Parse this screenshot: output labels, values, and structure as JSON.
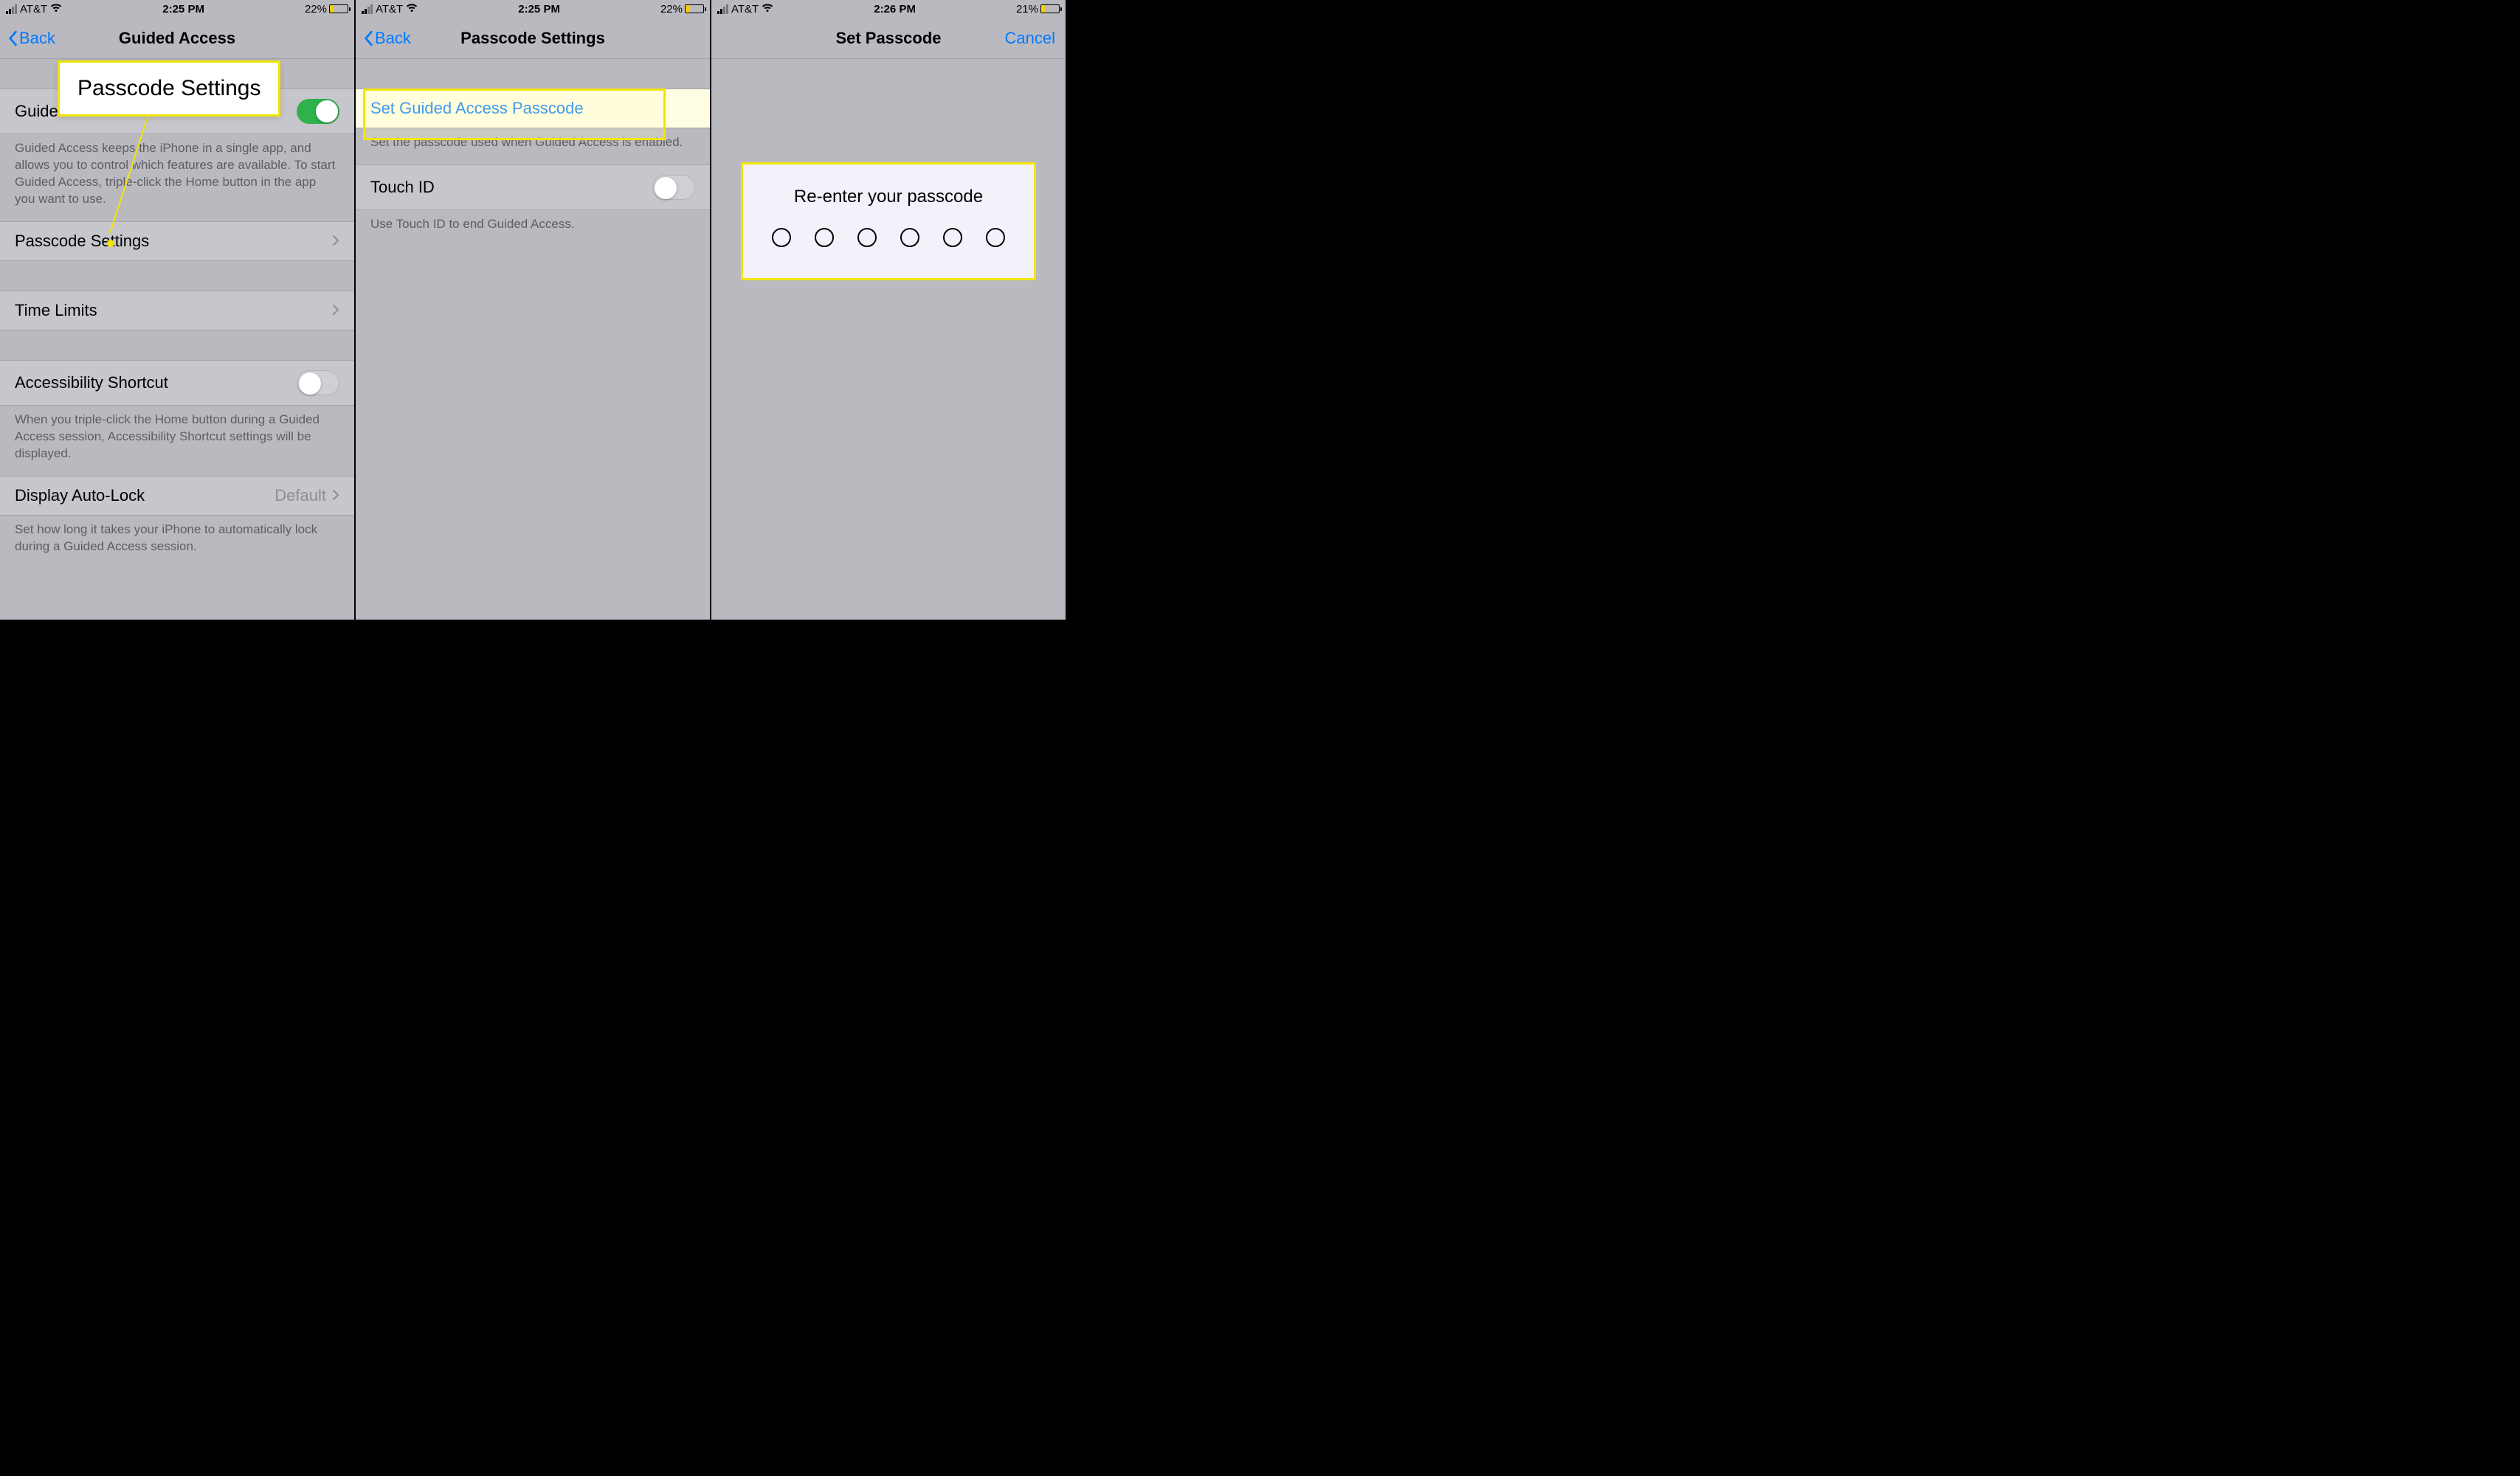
{
  "panel1": {
    "status": {
      "carrier": "AT&T",
      "time": "2:25 PM",
      "battery_pct": "22%",
      "battery_fill": 22
    },
    "nav": {
      "back": "Back",
      "title": "Guided Access"
    },
    "guided_access_row": "Guided Access",
    "guided_access_toggle": true,
    "guided_access_desc": "Guided Access keeps the iPhone in a single app, and allows you to control which features are available. To start Guided Access, triple-click the Home button in the app you want to use.",
    "passcode_settings_row": "Passcode Settings",
    "time_limits_row": "Time Limits",
    "accessibility_shortcut_row": "Accessibility Shortcut",
    "accessibility_shortcut_toggle": false,
    "accessibility_shortcut_desc": "When you triple-click the Home button during a Guided Access session, Accessibility Shortcut settings will be displayed.",
    "display_autolock_row": "Display Auto-Lock",
    "display_autolock_value": "Default",
    "display_autolock_desc": "Set how long it takes your iPhone to automatically lock during a Guided Access session.",
    "callout_label": "Passcode Settings"
  },
  "panel2": {
    "status": {
      "carrier": "AT&T",
      "time": "2:25 PM",
      "battery_pct": "22%",
      "battery_fill": 22
    },
    "nav": {
      "back": "Back",
      "title": "Passcode Settings"
    },
    "set_passcode_row": "Set Guided Access Passcode",
    "set_passcode_desc": "Set the passcode used when Guided Access is enabled.",
    "touchid_row": "Touch ID",
    "touchid_toggle": false,
    "touchid_desc": "Use Touch ID to end Guided Access."
  },
  "panel3": {
    "status": {
      "carrier": "AT&T",
      "time": "2:26 PM",
      "battery_pct": "21%",
      "battery_fill": 21
    },
    "nav": {
      "title": "Set Passcode",
      "cancel": "Cancel"
    },
    "prompt": "Re-enter your passcode",
    "dot_count": 6
  }
}
